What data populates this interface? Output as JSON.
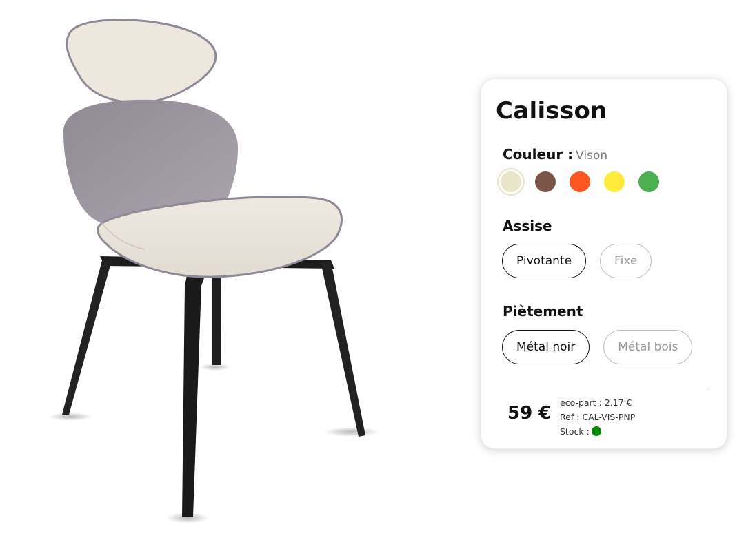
{
  "product": {
    "name": "Calisson"
  },
  "colors": {
    "label": "Couleur :",
    "selected_name": "Vison",
    "swatches": [
      {
        "name": "Vison",
        "hex": "#e9e5c8",
        "selected": true
      },
      {
        "name": "brown",
        "hex": "#7b5548",
        "selected": false
      },
      {
        "name": "orange",
        "hex": "#ff5722",
        "selected": false
      },
      {
        "name": "yellow",
        "hex": "#ffeb3b",
        "selected": false
      },
      {
        "name": "green",
        "hex": "#4caf50",
        "selected": false
      }
    ]
  },
  "seat": {
    "label": "Assise",
    "options": [
      {
        "label": "Pivotante",
        "selected": true
      },
      {
        "label": "Fixe",
        "selected": false
      }
    ]
  },
  "base": {
    "label": "Piètement",
    "options": [
      {
        "label": "Métal noir",
        "selected": true
      },
      {
        "label": "Métal bois",
        "selected": false
      }
    ]
  },
  "pricing": {
    "price": "59 €",
    "eco_part": "eco-part : 2.17 €",
    "ref": "Ref : CAL-VIS-PNP",
    "stock_label": "Stock :",
    "stock_color": "#008a00"
  },
  "icons": {
    "product_image": "chair-image"
  }
}
